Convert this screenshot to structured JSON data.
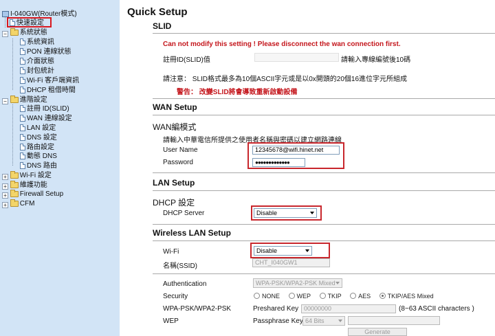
{
  "sidebar": {
    "root": "I-040GW(Router模式)",
    "quick_setup": "快速設定",
    "system_status": {
      "label": "系統狀態",
      "items": [
        "系統資訊",
        "PON 連線狀態",
        "介面狀態",
        "封包統計",
        "Wi-Fi 客戶端資訊",
        "DHCP 租借時間"
      ]
    },
    "advanced": {
      "label": "進階設定",
      "items": [
        "註冊 ID(SLID)",
        "WAN 連線設定",
        "LAN 設定",
        "DNS 設定",
        "路由設定",
        "動態 DNS",
        "DNS 路由"
      ]
    },
    "wifi": "Wi-Fi 設定",
    "maintenance": "維護功能",
    "firewall": "Firewall Setup",
    "cfm": "CFM"
  },
  "main": {
    "page_title": "Quick Setup",
    "slid": {
      "title": "SLID",
      "warning": "Can not modify this setting ! Please disconnect the wan connection first.",
      "reg_label": "註冊ID(SLID)值",
      "reg_hint": "請輸入專線編號後10碼",
      "note": "請注意： SLID格式最多為10個ASCII字元或是以0x開頭的20個16進位字元所組成",
      "alert": "警告： 改變SLID將會導致重新啟動設備"
    },
    "wan": {
      "title": "WAN Setup",
      "mode_title": "WAN編模式",
      "desc": "請輸入中華電信所提供之使用者名稱與密碼以建立網路連線",
      "username_label": "User Name",
      "username_value": "12345678@wifi.hinet.net",
      "password_label": "Password",
      "password_value": "●●●●●●●●●●●●●"
    },
    "lan": {
      "title": "LAN Setup",
      "dhcp_title": "DHCP 設定",
      "dhcp_server_label": "DHCP Server",
      "dhcp_server_value": "Disable"
    },
    "wireless": {
      "title": "Wireless LAN Setup",
      "wifi_label": "Wi-Fi",
      "wifi_value": "Disable",
      "ssid_label": "名稱(SSID)",
      "ssid_value": "CHT_I040GW1",
      "auth_label": "Authentication",
      "auth_value": "WPA-PSK/WPA2-PSK Mixed",
      "security_label": "Security",
      "security_options": [
        "NONE",
        "WEP",
        "TKIP",
        "AES",
        "TKIP/AES Mixed"
      ],
      "security_selected": "TKIP/AES Mixed",
      "psk_label": "WPA-PSK/WPA2-PSK",
      "preshared_label": "Preshared Key",
      "preshared_value": "00000000",
      "preshared_hint": "(8~63 ASCII characters )",
      "wep_label": "WEP",
      "passphrase_label": "Passphrase Key:",
      "passphrase_bits": "64 Bits",
      "generate_label": "Generate"
    }
  },
  "colors": {
    "sidebar_bg": "#d2e4f6",
    "highlight_red": "#c8262c",
    "warning_red": "#c4161c"
  }
}
